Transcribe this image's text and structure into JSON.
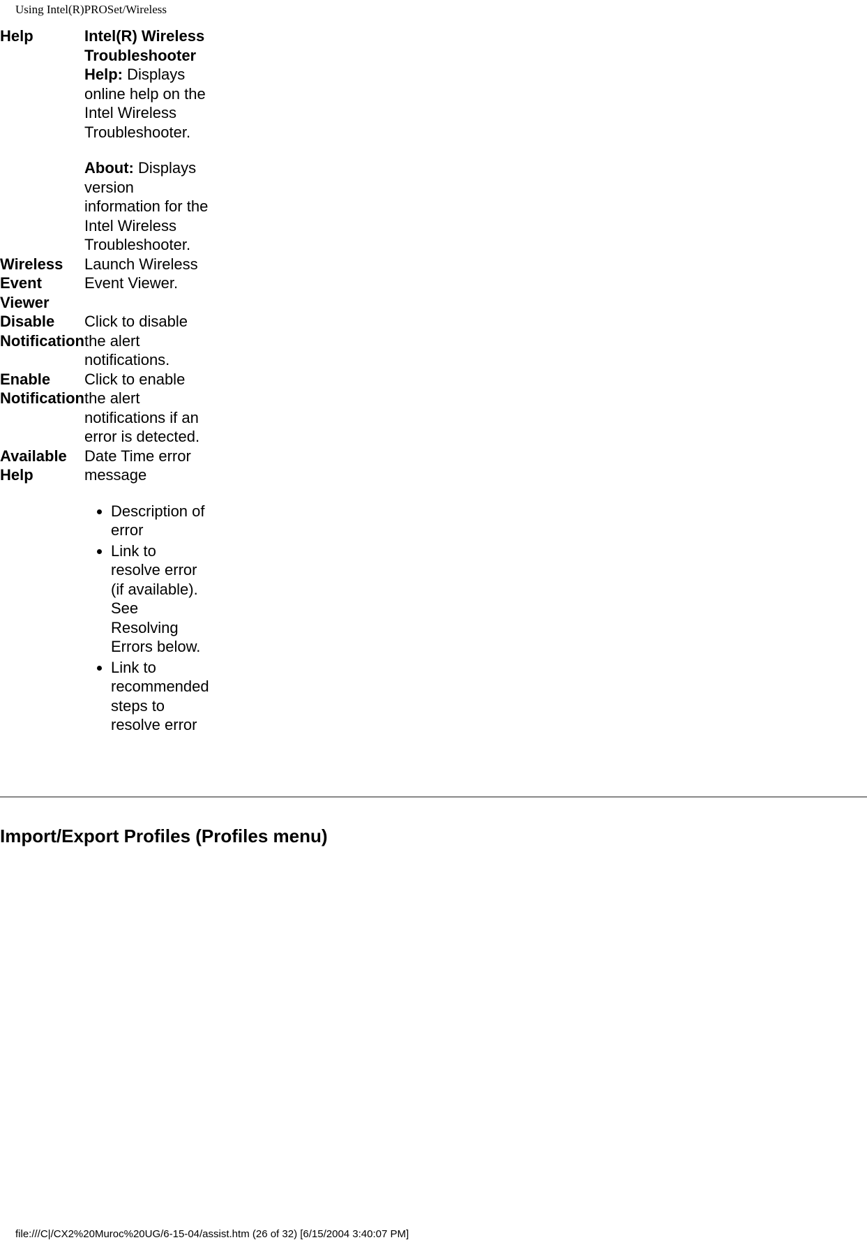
{
  "header": {
    "title": "Using Intel(R)PROSet/Wireless"
  },
  "rows": {
    "help": {
      "term": "Help",
      "para1_bold": "Intel(R) Wireless Troubleshooter Help:",
      "para1_rest": " Displays online help on the Intel Wireless Troubleshooter.",
      "para2_bold": "About:",
      "para2_rest": " Displays version information for the Intel Wireless Troubleshooter."
    },
    "wev": {
      "term": "Wireless Event Viewer",
      "desc": "Launch Wireless Event Viewer."
    },
    "disable": {
      "term": "Disable Notification",
      "desc": "Click to disable the alert notifications."
    },
    "enable": {
      "term": "Enable Notification",
      "desc": "Click to enable the alert notifications if an error is detected."
    },
    "avail": {
      "term": "Available Help",
      "intro": "Date Time error message",
      "b1": "Description of error",
      "b2": "Link to resolve error (if available). See Resolving Errors below.",
      "b3": "Link to recommended steps to resolve error"
    }
  },
  "section_heading": "Import/Export Profiles (Profiles menu)",
  "footer": "file:///C|/CX2%20Muroc%20UG/6-15-04/assist.htm (26 of 32) [6/15/2004 3:40:07 PM]"
}
